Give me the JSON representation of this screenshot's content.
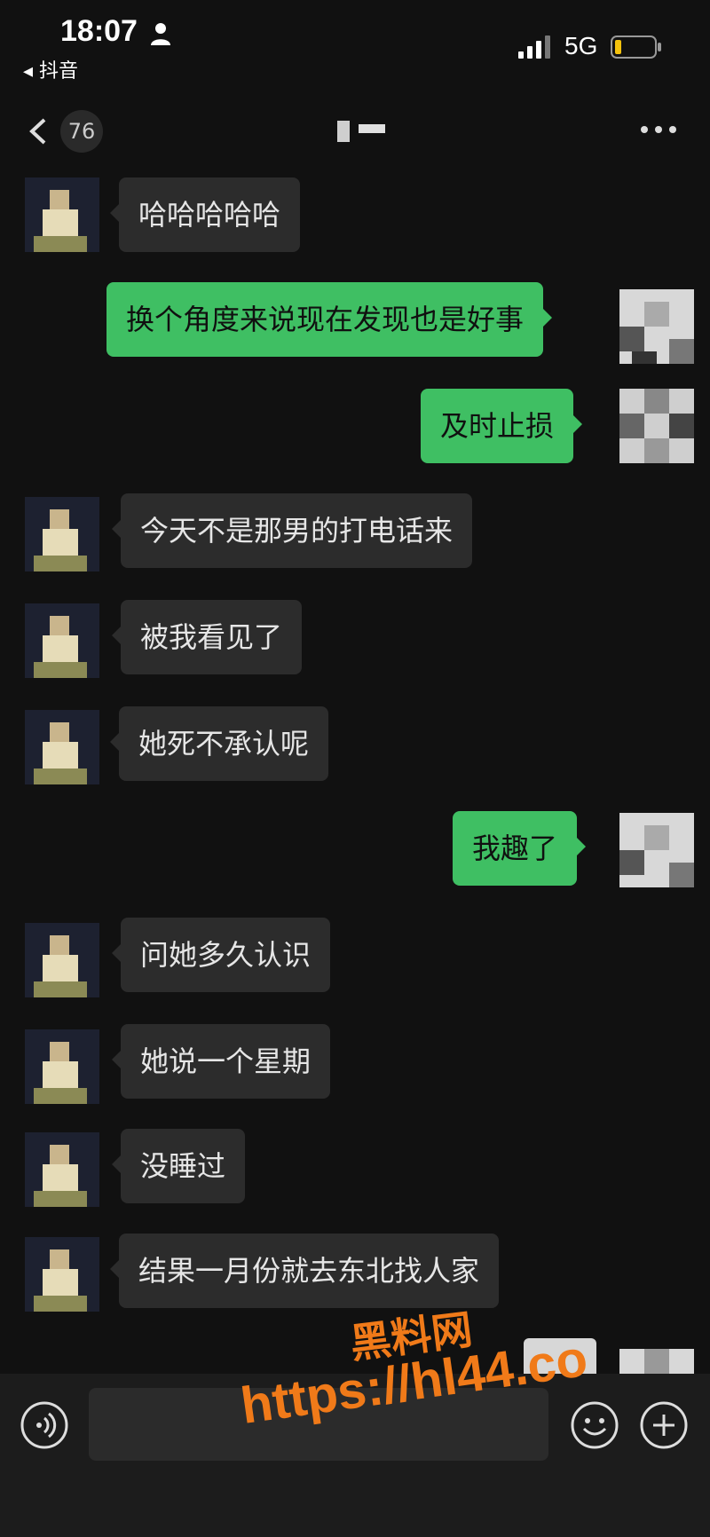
{
  "status_bar": {
    "time": "18:07",
    "back_app_label": "◂ 抖音",
    "network": "5G",
    "icons": [
      "person-icon",
      "signal-icon",
      "battery-icon"
    ]
  },
  "nav": {
    "unread_count": "76",
    "title": "",
    "icons": [
      "back-chevron-icon",
      "more-dots-icon"
    ]
  },
  "messages": [
    {
      "side": "in",
      "text": "哈哈哈哈哈"
    },
    {
      "side": "out",
      "text": "换个角度来说现在发现也是好事"
    },
    {
      "side": "out",
      "text": "及时止损"
    },
    {
      "side": "in",
      "text": "今天不是那男的打电话来"
    },
    {
      "side": "in",
      "text": "被我看见了"
    },
    {
      "side": "in",
      "text": "她死不承认呢"
    },
    {
      "side": "out",
      "text": "我趣了"
    },
    {
      "side": "in",
      "text": "问她多久认识"
    },
    {
      "side": "in",
      "text": "她说一个星期"
    },
    {
      "side": "in",
      "text": "没睡过"
    },
    {
      "side": "in",
      "text": "结果一月份就去东北找人家"
    }
  ],
  "input": {
    "value": "",
    "icons": [
      "voice-icon",
      "emoji-icon",
      "plus-icon"
    ]
  },
  "watermark": {
    "title": "黑料网",
    "url": "https://hl44.co"
  },
  "colors": {
    "background": "#111111",
    "incoming_bubble": "#2c2c2c",
    "outgoing_bubble": "#3fbf63",
    "watermark": "#f07a19"
  }
}
